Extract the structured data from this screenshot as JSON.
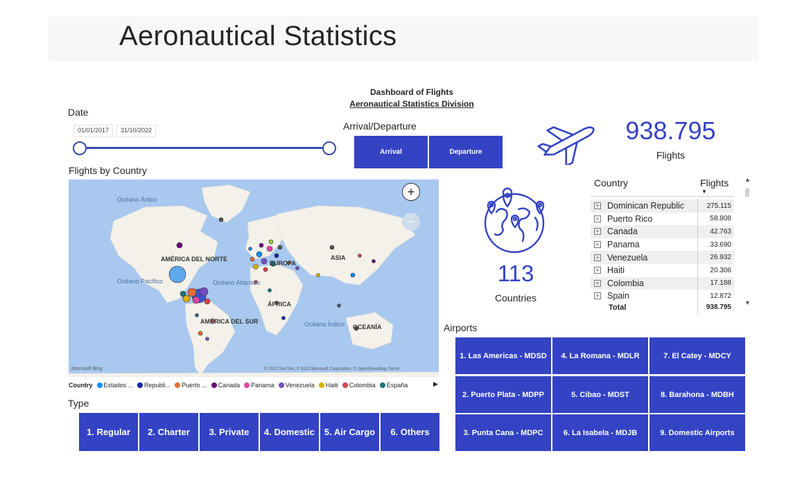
{
  "page": {
    "title": "Aeronautical Statistics",
    "dashboard_title": "Dashboard of Flights",
    "dashboard_subtitle": "Aeronautical Statistics Division"
  },
  "date_filter": {
    "label": "Date",
    "start": "01/01/2017",
    "end": "31/10/2022"
  },
  "arrival_departure": {
    "label": "Arrival/Departure",
    "buttons": [
      "Arrival",
      "Departure"
    ]
  },
  "flights_card": {
    "value": "938.795",
    "caption": "Flights",
    "icon": "airplane-icon"
  },
  "countries_card": {
    "value": "113",
    "caption": "Countries",
    "icon": "globe-pins-icon"
  },
  "map": {
    "label": "Flights by Country",
    "continents": [
      "AMÉRICA DEL NORTE",
      "EUROPA",
      "ASIA",
      "ÁFRICA",
      "AMÉRICA DEL SUR",
      "OCEANÍA"
    ],
    "oceans": [
      "Océano Ártico",
      "Océano Pacífico",
      "Océano Atlántico",
      "Océano Índico"
    ],
    "attribution": "© 2022 TomTom, © 2022 Microsoft Corporation, © OpenStreetMap  Terms",
    "bing": "Microsoft Bing",
    "zoom_in": "+",
    "zoom_out": "−"
  },
  "legend": {
    "title": "Country",
    "items": [
      {
        "label": "Estados ...",
        "color": "#118dff"
      },
      {
        "label": "Republi...",
        "color": "#12239e"
      },
      {
        "label": "Puerto ...",
        "color": "#e66c37"
      },
      {
        "label": "Canada",
        "color": "#6b007b"
      },
      {
        "label": "Panama",
        "color": "#e044a7"
      },
      {
        "label": "Venezuela",
        "color": "#744ec2"
      },
      {
        "label": "Haiti",
        "color": "#d9b300"
      },
      {
        "label": "Colombia",
        "color": "#d64550"
      },
      {
        "label": "España",
        "color": "#197278"
      }
    ],
    "next": "▶"
  },
  "type": {
    "label": "Type",
    "buttons": [
      "1. Regular",
      "2. Charter",
      "3. Private",
      "4. Domestic",
      "5. Air Cargo",
      "6. Others"
    ]
  },
  "table": {
    "headers": [
      "Country",
      "Flights"
    ],
    "sort_indicator": "▼",
    "expand_symbol": "+",
    "rows": [
      {
        "country": "Dominican Republic",
        "flights": "275.115"
      },
      {
        "country": "Puerto Rico",
        "flights": "58.808"
      },
      {
        "country": "Canada",
        "flights": "42.763"
      },
      {
        "country": "Panama",
        "flights": "33.690"
      },
      {
        "country": "Venezuela",
        "flights": "26.932"
      },
      {
        "country": "Haiti",
        "flights": "20.306"
      },
      {
        "country": "Colombia",
        "flights": "17.188"
      },
      {
        "country": "Spain",
        "flights": "12.872"
      }
    ],
    "total_label": "Total",
    "total_value": "938.795"
  },
  "airports": {
    "label": "Airports",
    "buttons": [
      "1. Las Americas - MDSD",
      "4. La Romana - MDLR",
      "7. El Catey - MDCY",
      "2. Puerto Plata - MDPP",
      "5. Cibao - MDST",
      "8. Barahona - MDBH",
      "3. Punta Cana - MDPC",
      "6. La Isabela - MDJB",
      "9. Domestic Airports"
    ]
  },
  "colors": {
    "accent": "#3343c4",
    "map_water": "#a8c8f0",
    "map_land": "#f3f1ea"
  }
}
